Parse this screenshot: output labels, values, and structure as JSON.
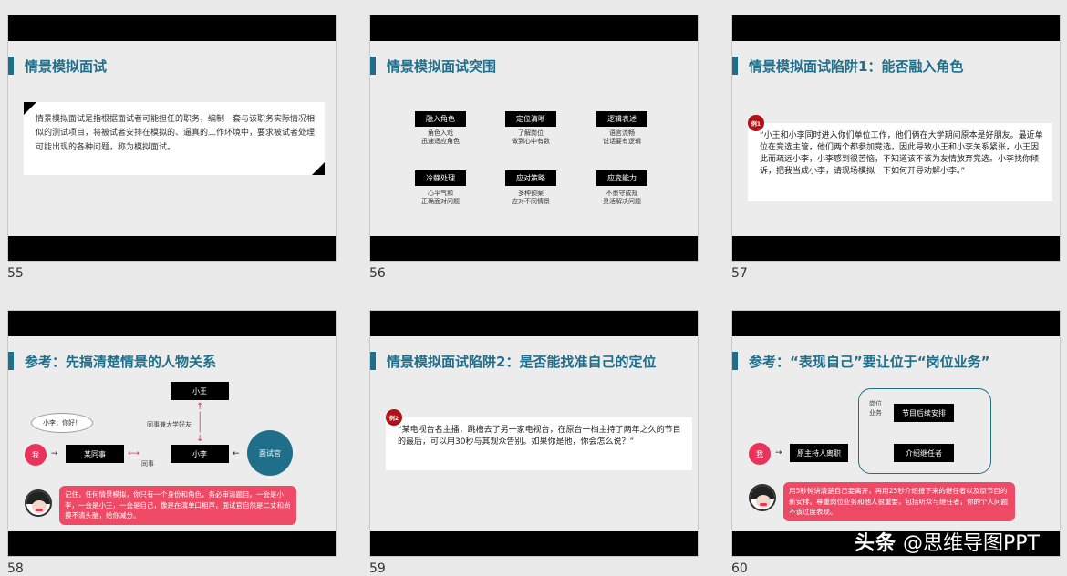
{
  "slides": [
    {
      "number": "55",
      "title": "情景模拟面试",
      "body": "情景模拟面试是指根据面试者可能担任的职务，编制一套与该职务实际情况相似的测试项目，将被试者安排在模拟的、逼真的工作环境中，要求被试者处理可能出现的各种问题，称为模拟面试。"
    },
    {
      "number": "56",
      "title": "情景模拟面试突围",
      "items": [
        {
          "label": "融入角色",
          "desc": "角色入戏\n迅速适应角色"
        },
        {
          "label": "定位清晰",
          "desc": "了解岗位\n做到心中有数"
        },
        {
          "label": "逻辑表述",
          "desc": "语言流畅\n说话要有逻辑"
        },
        {
          "label": "冷静处理",
          "desc": "心平气和\n正确面对问题"
        },
        {
          "label": "应对策略",
          "desc": "多种预案\n应对不同情景"
        },
        {
          "label": "应变能力",
          "desc": "不墨守成规\n灵活解决问题"
        }
      ]
    },
    {
      "number": "57",
      "title": "情景模拟面试陷阱1：能否融入角色",
      "badge": "例1",
      "quote": "“小王和小李同时进入你们单位工作，他们俩在大学期间原本是好朋友。最近单位在竞选主管，他们两个都参加竞选，因此导致小王和小李关系紧张，小王因此而疏远小李，小李感到很苦恼，不知道该不该为友情放弃竞选。小李找你倾诉，把我当成小李，请现场模拟一下如何开导劝解小李。”"
    },
    {
      "number": "58",
      "title": "参考：先搞清楚情景的人物关系",
      "bubble": "小李，你好！",
      "me": "我",
      "node_colleague": "某同事",
      "node_xiaowang": "小王",
      "node_xiaoli": "小李",
      "interviewer": "面试官",
      "label_classmate": "同事兼大学好友",
      "label_colleague": "同事",
      "tip": "记住，任何情景模拟，你只有一个身份和角色，务必审清题目。一会是小李，一会是小王，一会是自己，像是在演单口相声，面试官自然是二丈和尚摸不清头脑，给你减分。"
    },
    {
      "number": "59",
      "title": "情景模拟面试陷阱2：是否能找准自己的定位",
      "badge": "例2",
      "quote": "“某电视台名主播，跳槽去了另一家电视台，在原台一档主持了两年之久的节目的最后，可以用30秒与其观众告别。如果你是他，你会怎么说？”"
    },
    {
      "number": "60",
      "title": "参考：“表现自己”要让位于“岗位业务”",
      "group_label": "岗位\n业务",
      "node_schedule": "节目后续安排",
      "node_successor": "介绍继任者",
      "me": "我",
      "node_leave": "原主持人离职",
      "tip": "用5秒钟讲清楚自己要离开，再用25秒介绍接下来的继任者以及原节目的新安排。尊重岗位业务和他人很重要，包括听众与继任者，你的个人问题不该过度表现。"
    }
  ],
  "watermark": {
    "brand": "头条",
    "handle": "@思维导图PPT"
  },
  "colors": {
    "accent": "#1f6f8b",
    "red": "#b01016",
    "pink": "#ee4a66",
    "teal": "#1f6f8b"
  }
}
